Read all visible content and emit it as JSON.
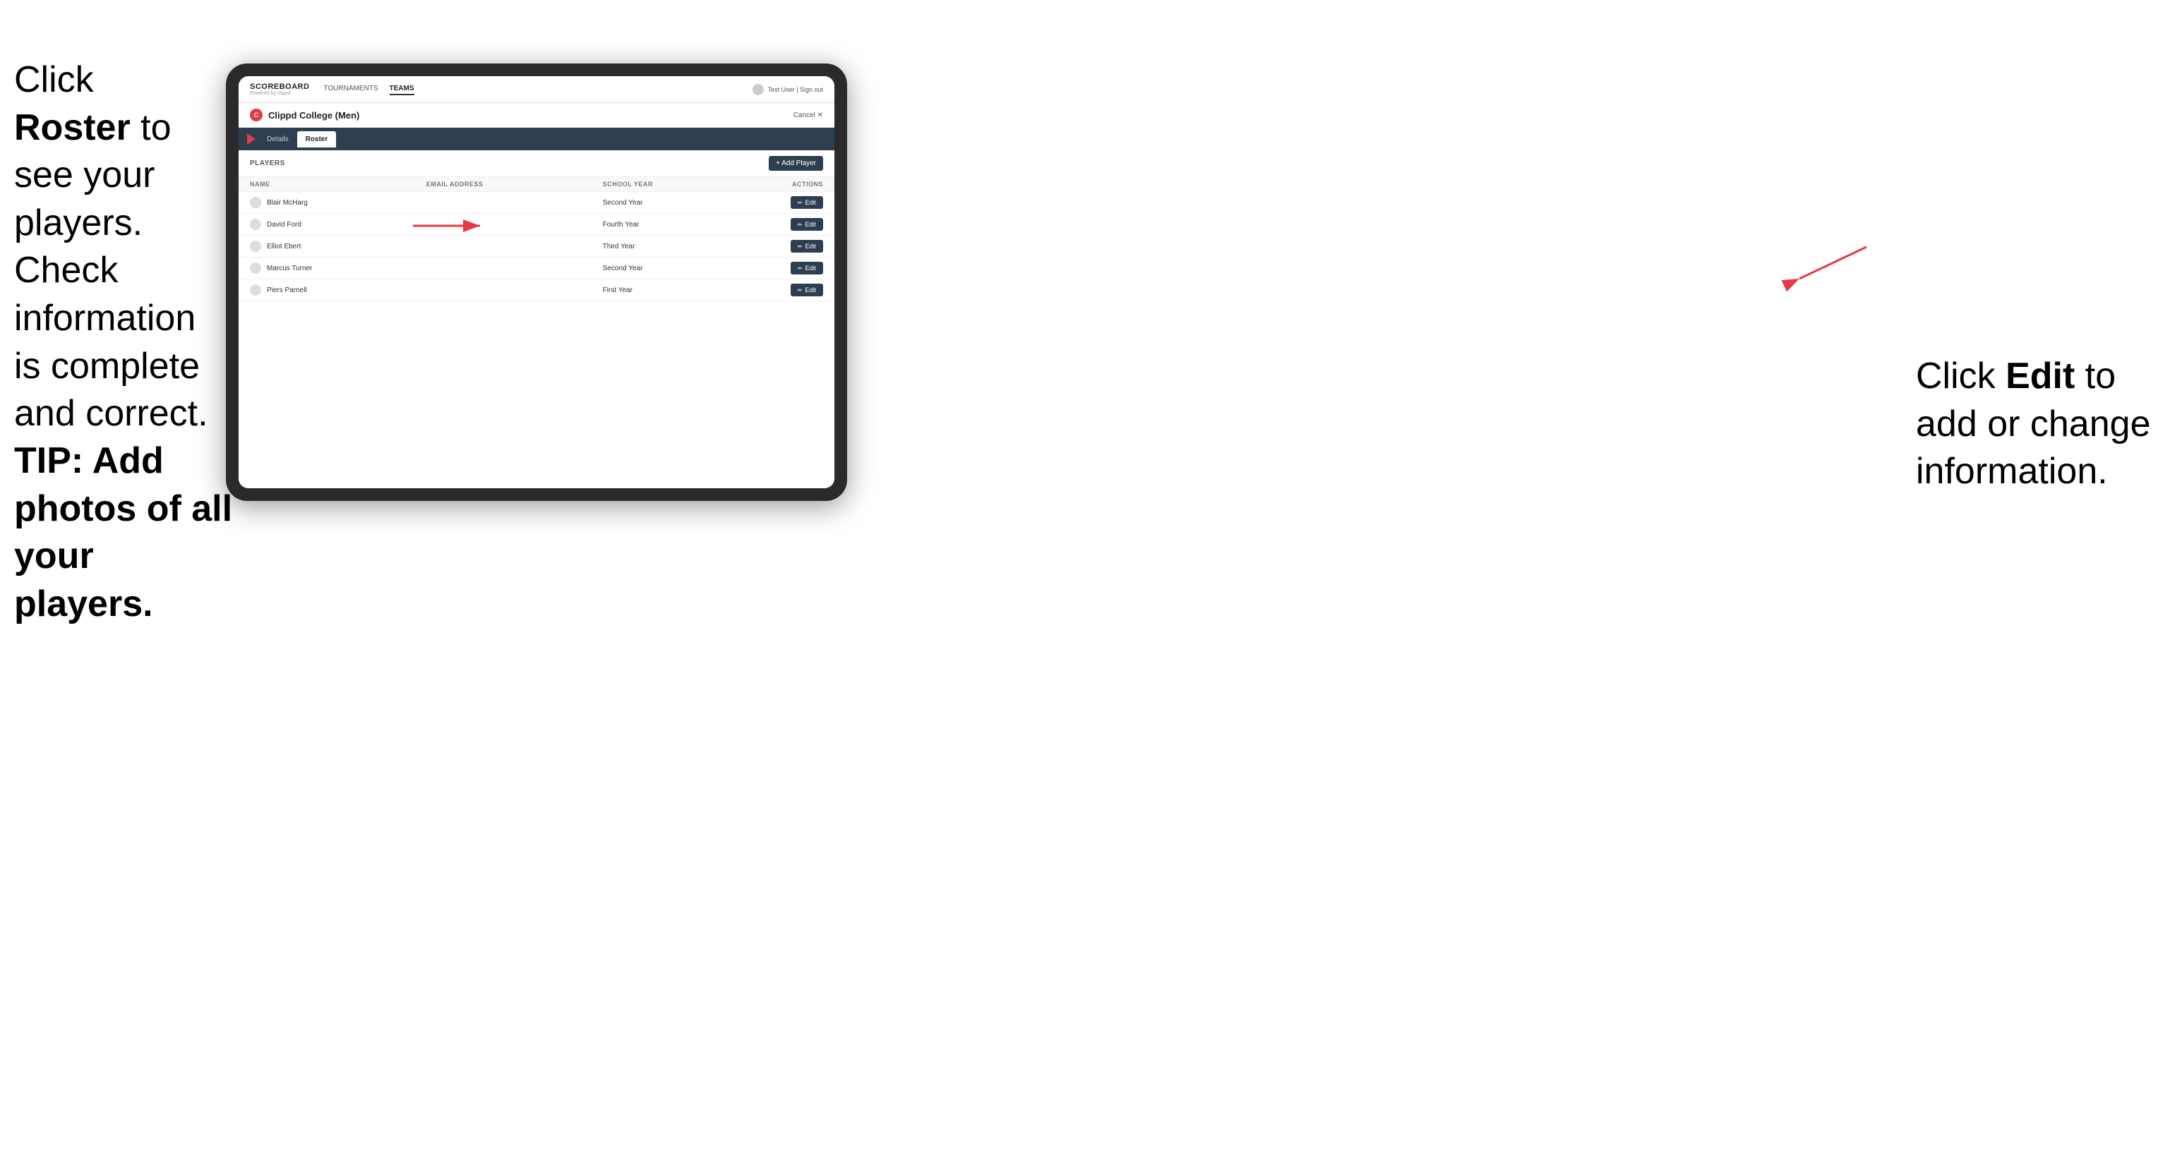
{
  "page": {
    "background": "#fff"
  },
  "instructions": {
    "main_text_1": "Click ",
    "main_bold": "Roster",
    "main_text_2": " to see your players. Check information is complete and correct.",
    "tip_text": "TIP: Add photos of all your players.",
    "right_text_1": "Click ",
    "right_bold": "Edit",
    "right_text_2": " to add or change information."
  },
  "nav": {
    "brand": "SCOREBOARD",
    "brand_sub": "Powered by clippd",
    "links": [
      "TOURNAMENTS",
      "TEAMS"
    ],
    "active_link": "TEAMS",
    "user": "Test User | Sign out"
  },
  "team": {
    "logo_letter": "C",
    "name": "Clippd College (Men)",
    "cancel_label": "Cancel ✕"
  },
  "tabs": [
    {
      "label": "Details",
      "active": false
    },
    {
      "label": "Roster",
      "active": true
    }
  ],
  "players_section": {
    "header": "PLAYERS",
    "add_button": "+ Add Player",
    "columns": {
      "name": "NAME",
      "email": "EMAIL ADDRESS",
      "school_year": "SCHOOL YEAR",
      "actions": "ACTIONS"
    },
    "players": [
      {
        "name": "Blair McHarg",
        "email": "",
        "school_year": "Second Year"
      },
      {
        "name": "David Ford",
        "email": "",
        "school_year": "Fourth Year"
      },
      {
        "name": "Elliot Ebert",
        "email": "",
        "school_year": "Third Year"
      },
      {
        "name": "Marcus Turner",
        "email": "",
        "school_year": "Second Year"
      },
      {
        "name": "Piers Parnell",
        "email": "",
        "school_year": "First Year"
      }
    ],
    "edit_label": "Edit"
  }
}
